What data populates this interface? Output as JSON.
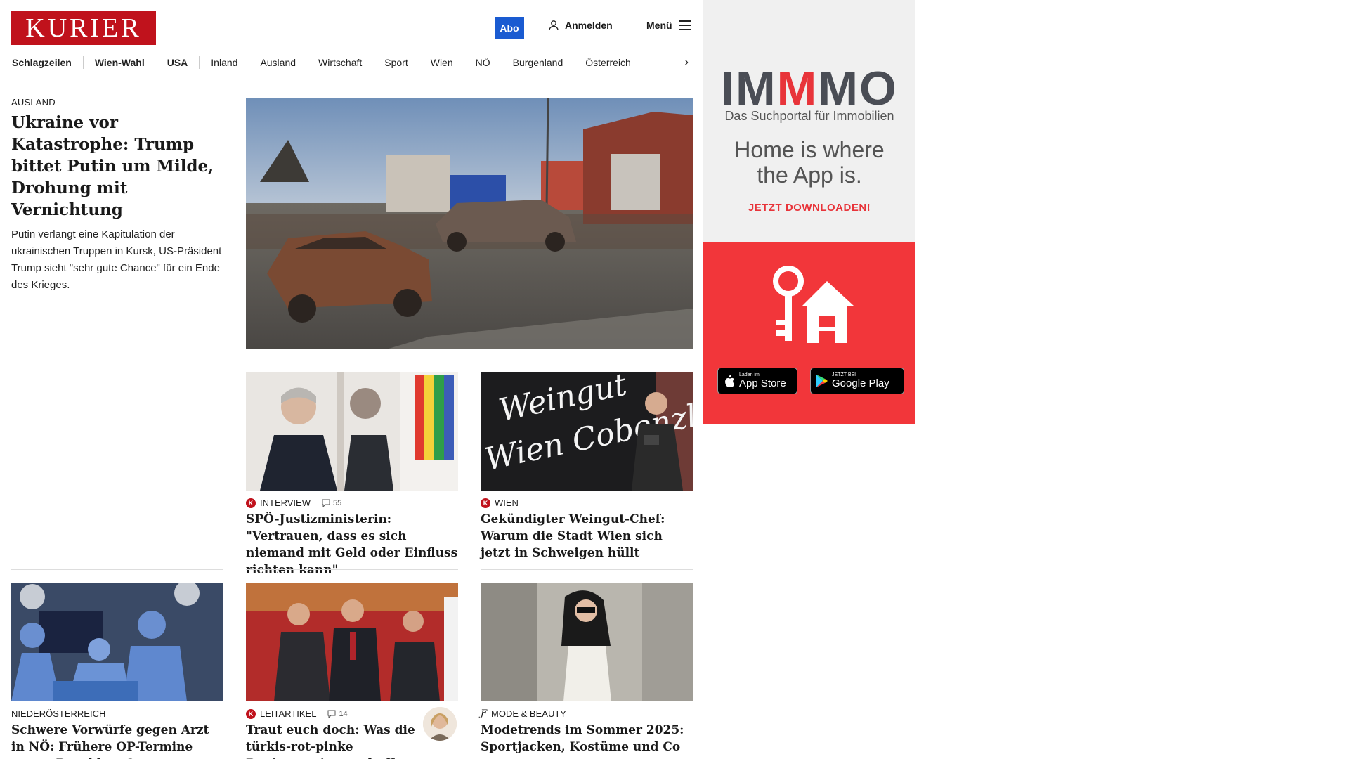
{
  "header": {
    "logo": "KURIER",
    "abo_label": "Abo",
    "login_label": "Anmelden",
    "menu_label": "Menü"
  },
  "nav": {
    "items": [
      {
        "label": "Schlagzeilen",
        "bold": true
      },
      {
        "label": "Wien-Wahl",
        "bold": true
      },
      {
        "label": "USA",
        "bold": true
      },
      {
        "label": "Inland",
        "bold": false
      },
      {
        "label": "Ausland",
        "bold": false
      },
      {
        "label": "Wirtschaft",
        "bold": false
      },
      {
        "label": "Sport",
        "bold": false
      },
      {
        "label": "Wien",
        "bold": false
      },
      {
        "label": "NÖ",
        "bold": false
      },
      {
        "label": "Burgenland",
        "bold": false
      },
      {
        "label": "Österreich",
        "bold": false
      }
    ]
  },
  "lead": {
    "category": "AUSLAND",
    "title": "Ukraine vor Katastrophe: Trump bittet Putin um Milde, Drohung mit Vernichtung",
    "teaser": "Putin verlangt eine Kapitulation der ukrainischen Truppen in Kursk, US-Präsident Trump sieht \"sehr gute Chance\" für ein Ende des Krieges."
  },
  "cards": {
    "justiz": {
      "category": "INTERVIEW",
      "comments": "55",
      "title": "SPÖ-Justizministerin: \"Vertrauen, dass es sich niemand mit Geld oder Einfluss richten kann\""
    },
    "weingut": {
      "category": "WIEN",
      "title": "Gekündigter Weingut-Chef: Warum die Stadt Wien sich jetzt in Schweigen hüllt",
      "image_text": "Weingut Wien Cobenzl"
    },
    "arzt": {
      "category": "NIEDERÖSTERREICH",
      "title": "Schwere Vorwürfe gegen Arzt in NÖ: Frühere OP-Termine gegen Bezahlung?"
    },
    "leitartikel": {
      "category": "LEITARTIKEL",
      "comments": "14",
      "title": "Traut euch doch: Was die türkis-rot-pinke Regierung jetzt schaffen muss"
    },
    "mode": {
      "category": "MODE & BEAUTY",
      "title": "Modetrends im Sommer 2025: Sportjacken, Kostüme und Co"
    }
  },
  "ad": {
    "brand_left": "IM",
    "brand_mid": "M",
    "brand_right": "MO",
    "subtitle": "Das Suchportal für Immobilien",
    "slogan": "Home is where the App is.",
    "cta": "JETZT DOWNLOADEN!",
    "appstore_small": "Laden im",
    "appstore_big": "App Store",
    "googleplay_small": "JETZT BEI",
    "googleplay_big": "Google Play"
  },
  "colors": {
    "brand_red": "#c0121c",
    "abo_blue": "#1a5bd1",
    "ad_red": "#f2363a"
  }
}
